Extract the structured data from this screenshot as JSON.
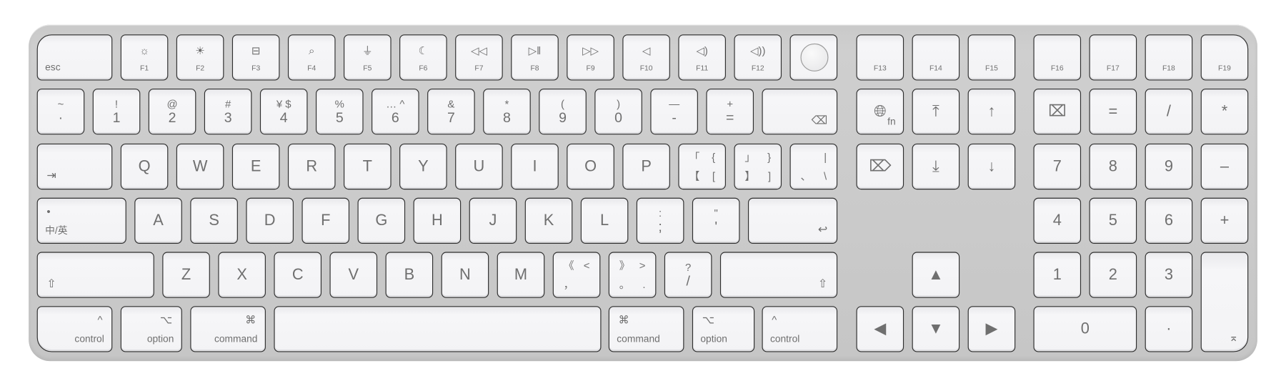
{
  "keyboard": {
    "colors": {
      "body": "#c9c9c9",
      "key": "#f3f3f5",
      "legend": "#6f6f6f",
      "outline": "#2f2f2f"
    },
    "rows": [
      [
        {
          "id": "esc",
          "bl": "esc"
        },
        {
          "id": "f1",
          "icon": "brightness-down",
          "b": "F1"
        },
        {
          "id": "f2",
          "icon": "brightness-up",
          "b": "F2"
        },
        {
          "id": "f3",
          "icon": "mission-control",
          "b": "F3"
        },
        {
          "id": "f4",
          "icon": "search",
          "b": "F4"
        },
        {
          "id": "f5",
          "icon": "microphone",
          "b": "F5"
        },
        {
          "id": "f6",
          "icon": "moon",
          "b": "F6"
        },
        {
          "id": "f7",
          "icon": "rewind",
          "b": "F7"
        },
        {
          "id": "f8",
          "icon": "play-pause",
          "b": "F8"
        },
        {
          "id": "f9",
          "icon": "fast-forward",
          "b": "F9"
        },
        {
          "id": "f10",
          "icon": "mute",
          "b": "F10"
        },
        {
          "id": "f11",
          "icon": "volume-down",
          "b": "F11"
        },
        {
          "id": "f12",
          "icon": "volume-up",
          "b": "F12"
        },
        {
          "id": "touch-id",
          "touch": true
        },
        {
          "id": "f13",
          "b": "F13"
        },
        {
          "id": "f14",
          "b": "F14"
        },
        {
          "id": "f15",
          "b": "F15"
        },
        {
          "id": "f16",
          "b": "F16"
        },
        {
          "id": "f17",
          "b": "F17"
        },
        {
          "id": "f18",
          "b": "F18"
        },
        {
          "id": "f19",
          "b": "F19"
        }
      ],
      [
        {
          "id": "tilde",
          "t": "~",
          "b": "·"
        },
        {
          "id": "1",
          "t": "!",
          "b": "1"
        },
        {
          "id": "2",
          "t": "@",
          "b": "2"
        },
        {
          "id": "3",
          "t": "#",
          "b": "3"
        },
        {
          "id": "4",
          "t": "¥  $",
          "b": "4"
        },
        {
          "id": "5",
          "t": "%",
          "b": "5"
        },
        {
          "id": "6",
          "t": "…  ^",
          "b": "6"
        },
        {
          "id": "7",
          "t": "&",
          "b": "7"
        },
        {
          "id": "8",
          "t": "*",
          "b": "8"
        },
        {
          "id": "9",
          "t": "(",
          "b": "9"
        },
        {
          "id": "0",
          "t": ")",
          "b": "0"
        },
        {
          "id": "minus",
          "t": "—",
          "b": "-"
        },
        {
          "id": "equals",
          "t": "+",
          "b": "="
        },
        {
          "id": "delete",
          "brs": "⌫"
        },
        {
          "id": "fn-globe",
          "c": "🌐︎",
          "br": "fn"
        },
        {
          "id": "home",
          "c": "⤒"
        },
        {
          "id": "page-up",
          "c": "↑"
        },
        {
          "id": "clear",
          "c": "⌧"
        },
        {
          "id": "num-equals",
          "c": "="
        },
        {
          "id": "num-slash",
          "c": "/"
        },
        {
          "id": "num-asterisk",
          "c": "*"
        }
      ],
      [
        {
          "id": "tab",
          "bls": "⇥"
        },
        {
          "id": "q",
          "c": "Q"
        },
        {
          "id": "w",
          "c": "W"
        },
        {
          "id": "e",
          "c": "E"
        },
        {
          "id": "r",
          "c": "R"
        },
        {
          "id": "t",
          "c": "T"
        },
        {
          "id": "y",
          "c": "Y"
        },
        {
          "id": "u",
          "c": "U"
        },
        {
          "id": "i",
          "c": "I"
        },
        {
          "id": "o",
          "c": "O"
        },
        {
          "id": "p",
          "c": "P"
        },
        {
          "id": "left-bracket",
          "qtl": "「",
          "qtr": "{",
          "qbl": "【",
          "qbr": "["
        },
        {
          "id": "right-bracket",
          "qtl": "」",
          "qtr": "}",
          "qbl": "】",
          "qbr": "]"
        },
        {
          "id": "backslash",
          "qtr": "|",
          "qbl": "、",
          "qbr": "\\"
        },
        {
          "id": "forward-delete",
          "c": "⌦"
        },
        {
          "id": "end",
          "c": "⤓"
        },
        {
          "id": "page-down",
          "c": "↓"
        },
        {
          "id": "num-7",
          "c": "7"
        },
        {
          "id": "num-8",
          "c": "8"
        },
        {
          "id": "num-9",
          "c": "9"
        },
        {
          "id": "num-minus",
          "c": "–"
        }
      ],
      [
        {
          "id": "caps-lock",
          "tl": "•",
          "bl": "中/英"
        },
        {
          "id": "a",
          "c": "A"
        },
        {
          "id": "s",
          "c": "S"
        },
        {
          "id": "d",
          "c": "D"
        },
        {
          "id": "f",
          "c": "F"
        },
        {
          "id": "g",
          "c": "G"
        },
        {
          "id": "h",
          "c": "H"
        },
        {
          "id": "j",
          "c": "J"
        },
        {
          "id": "k",
          "c": "K"
        },
        {
          "id": "l",
          "c": "L"
        },
        {
          "id": "semicolon",
          "t": ":",
          "b": ";"
        },
        {
          "id": "quote",
          "t": "\"",
          "b": "'"
        },
        {
          "id": "return",
          "brs": "↩"
        },
        {
          "id": "num-4",
          "c": "4"
        },
        {
          "id": "num-5",
          "c": "5"
        },
        {
          "id": "num-6",
          "c": "6"
        },
        {
          "id": "num-plus",
          "c": "+"
        }
      ],
      [
        {
          "id": "left-shift",
          "bls": "⇧"
        },
        {
          "id": "z",
          "c": "Z"
        },
        {
          "id": "x",
          "c": "X"
        },
        {
          "id": "c",
          "c": "C"
        },
        {
          "id": "v",
          "c": "V"
        },
        {
          "id": "b",
          "c": "B"
        },
        {
          "id": "n",
          "c": "N"
        },
        {
          "id": "m",
          "c": "M"
        },
        {
          "id": "comma",
          "qtl": "《",
          "qtr": "<",
          "qbl": "，"
        },
        {
          "id": "period",
          "qtl": "》",
          "qtr": ">",
          "qbl": "。",
          "qbr": "."
        },
        {
          "id": "slash",
          "t": "?",
          "b": "/"
        },
        {
          "id": "right-shift",
          "brs": "⇧"
        },
        {
          "id": "arrow-up",
          "c": "▲"
        },
        {
          "id": "num-1",
          "c": "1"
        },
        {
          "id": "num-2",
          "c": "2"
        },
        {
          "id": "num-3",
          "c": "3"
        },
        {
          "id": "num-enter",
          "brs": "⌅"
        }
      ],
      [
        {
          "id": "left-control",
          "tr": "^",
          "br": "control"
        },
        {
          "id": "left-option",
          "tr": "⌥",
          "br": "option"
        },
        {
          "id": "left-command",
          "tr": "⌘",
          "br": "command"
        },
        {
          "id": "space"
        },
        {
          "id": "right-command",
          "tl": "⌘",
          "bl": "command"
        },
        {
          "id": "right-option",
          "tl": "⌥",
          "bl": "option"
        },
        {
          "id": "right-control",
          "tl": "^",
          "bl": "control"
        },
        {
          "id": "arrow-left",
          "c": "◀"
        },
        {
          "id": "arrow-down",
          "c": "▼"
        },
        {
          "id": "arrow-right",
          "c": "▶"
        },
        {
          "id": "num-0",
          "c": "0"
        },
        {
          "id": "num-decimal",
          "c": "·"
        }
      ]
    ]
  }
}
